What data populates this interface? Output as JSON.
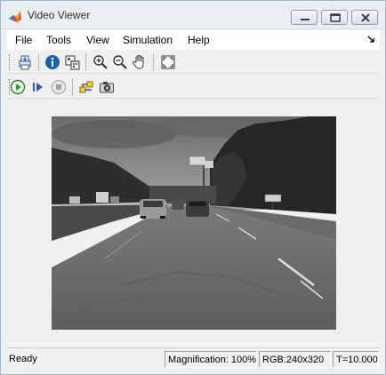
{
  "window": {
    "title": "Video Viewer",
    "icon": "matlab-logo-icon"
  },
  "menubar": {
    "items": [
      "File",
      "Tools",
      "View",
      "Simulation",
      "Help"
    ],
    "overflow_icon": "dock-arrow-icon"
  },
  "toolbar1": {
    "buttons": [
      {
        "name": "print-icon"
      },
      {
        "name": "info-icon"
      },
      {
        "name": "pixel-region-icon"
      },
      {
        "name": "zoom-in-icon"
      },
      {
        "name": "zoom-out-icon"
      },
      {
        "name": "pan-hand-icon"
      },
      {
        "name": "fit-to-window-icon"
      }
    ]
  },
  "toolbar2": {
    "buttons": [
      {
        "name": "play-icon"
      },
      {
        "name": "step-forward-icon"
      },
      {
        "name": "stop-icon"
      },
      {
        "name": "highlight-simulink-signal-icon"
      },
      {
        "name": "snapshot-camera-icon"
      }
    ]
  },
  "video": {
    "description_only_visual": true
  },
  "status": {
    "state": "Ready",
    "magnification": "Magnification: 100%",
    "format": "RGB:240x320",
    "time": "T=10.000"
  },
  "colors": {
    "play_green": "#2e9b2e",
    "info_blue": "#1f5fa8",
    "title_bg": "#e9eef4",
    "window_bg": "#f0f0f0"
  }
}
